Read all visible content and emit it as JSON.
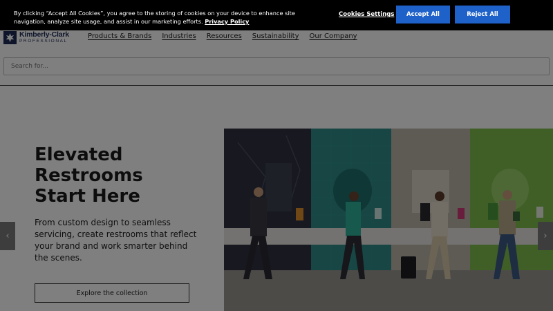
{
  "brand": {
    "name": "Kimberly-Clark",
    "sub": "PROFESSIONAL"
  },
  "nav": {
    "items": [
      {
        "label": "Products & Brands"
      },
      {
        "label": "Industries"
      },
      {
        "label": "Resources"
      },
      {
        "label": "Sustainability"
      },
      {
        "label": "Our Company"
      }
    ]
  },
  "search": {
    "placeholder": "Search for..."
  },
  "hero": {
    "title_lines": [
      "Elevated",
      "Restrooms",
      "Start Here"
    ],
    "description": "From custom design to seamless servicing, create restrooms that reflect your brand and work smarter behind the scenes.",
    "cta_label": "Explore the collection"
  },
  "carousel": {
    "prev_icon": "chevron-left-icon",
    "next_icon": "chevron-right-icon",
    "prev_glyph": "‹",
    "next_glyph": "›"
  },
  "cookie": {
    "text": "By clicking “Accept All Cookies”, you agree to the storing of cookies on your device to enhance site navigation, analyze site usage, and assist in our marketing efforts.",
    "policy_link": "Privacy Policy",
    "settings_label": "Cookies Settings",
    "accept_label": "Accept All",
    "reject_label": "Reject All"
  },
  "colors": {
    "banner_bg": "#000000",
    "button_blue": "#1e61c9",
    "brand_navy": "#1d2a55"
  }
}
